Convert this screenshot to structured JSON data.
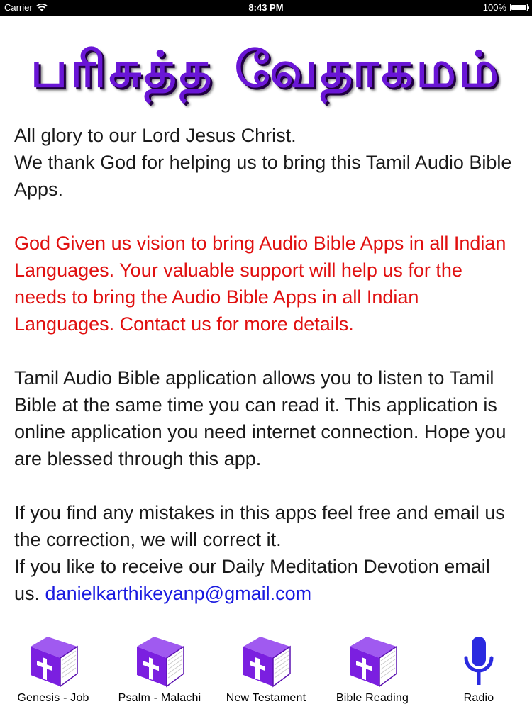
{
  "status_bar": {
    "carrier": "Carrier",
    "time": "8:43 PM",
    "battery": "100%"
  },
  "header": {
    "title": "பரிசுத்த வேதாகமம்"
  },
  "content": {
    "intro_line1": "All glory to our Lord Jesus Christ.",
    "intro_line2": "We thank God for helping us to bring this Tamil Audio Bible Apps.",
    "vision": "God Given us vision to bring Audio Bible Apps in all Indian Languages. Your valuable support will help us for the needs to bring the Audio Bible Apps in all Indian Languages. Contact us for more details.",
    "about": "Tamil Audio Bible application allows you to listen to Tamil Bible at the same time you can read it. This application is online application you need internet connection. Hope you are blessed through this app.",
    "mistakes": "If you find any mistakes in this apps feel free and email us the correction, we will correct it.",
    "devotion_prefix": "If you like to receive our Daily Meditation Devotion email us. ",
    "email": "danielkarthikeyanp@gmail.com"
  },
  "tabs": [
    {
      "label": "Genesis - Job",
      "icon": "bible-book-icon"
    },
    {
      "label": "Psalm - Malachi",
      "icon": "bible-book-icon"
    },
    {
      "label": "New Testament",
      "icon": "bible-book-icon"
    },
    {
      "label": "Bible Reading",
      "icon": "bible-book-icon"
    },
    {
      "label": "Radio",
      "icon": "microphone-icon"
    }
  ],
  "colors": {
    "title_purple": "#6a16d6",
    "vision_red": "#e01010",
    "email_blue": "#1a1ae0",
    "book_purple": "#7b1fe0",
    "mic_blue": "#2a2ae0"
  }
}
